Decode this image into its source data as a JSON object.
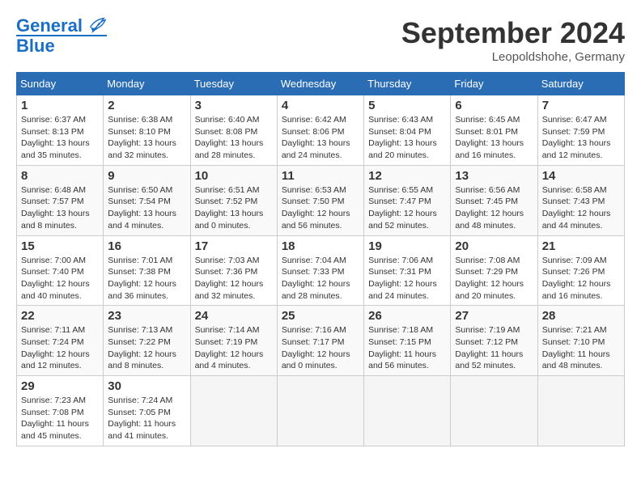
{
  "header": {
    "logo_line1": "General",
    "logo_line2": "Blue",
    "month": "September 2024",
    "location": "Leopoldshohe, Germany"
  },
  "weekdays": [
    "Sunday",
    "Monday",
    "Tuesday",
    "Wednesday",
    "Thursday",
    "Friday",
    "Saturday"
  ],
  "weeks": [
    [
      {
        "day": "1",
        "info": "Sunrise: 6:37 AM\nSunset: 8:13 PM\nDaylight: 13 hours\nand 35 minutes."
      },
      {
        "day": "2",
        "info": "Sunrise: 6:38 AM\nSunset: 8:10 PM\nDaylight: 13 hours\nand 32 minutes."
      },
      {
        "day": "3",
        "info": "Sunrise: 6:40 AM\nSunset: 8:08 PM\nDaylight: 13 hours\nand 28 minutes."
      },
      {
        "day": "4",
        "info": "Sunrise: 6:42 AM\nSunset: 8:06 PM\nDaylight: 13 hours\nand 24 minutes."
      },
      {
        "day": "5",
        "info": "Sunrise: 6:43 AM\nSunset: 8:04 PM\nDaylight: 13 hours\nand 20 minutes."
      },
      {
        "day": "6",
        "info": "Sunrise: 6:45 AM\nSunset: 8:01 PM\nDaylight: 13 hours\nand 16 minutes."
      },
      {
        "day": "7",
        "info": "Sunrise: 6:47 AM\nSunset: 7:59 PM\nDaylight: 13 hours\nand 12 minutes."
      }
    ],
    [
      {
        "day": "8",
        "info": "Sunrise: 6:48 AM\nSunset: 7:57 PM\nDaylight: 13 hours\nand 8 minutes."
      },
      {
        "day": "9",
        "info": "Sunrise: 6:50 AM\nSunset: 7:54 PM\nDaylight: 13 hours\nand 4 minutes."
      },
      {
        "day": "10",
        "info": "Sunrise: 6:51 AM\nSunset: 7:52 PM\nDaylight: 13 hours\nand 0 minutes."
      },
      {
        "day": "11",
        "info": "Sunrise: 6:53 AM\nSunset: 7:50 PM\nDaylight: 12 hours\nand 56 minutes."
      },
      {
        "day": "12",
        "info": "Sunrise: 6:55 AM\nSunset: 7:47 PM\nDaylight: 12 hours\nand 52 minutes."
      },
      {
        "day": "13",
        "info": "Sunrise: 6:56 AM\nSunset: 7:45 PM\nDaylight: 12 hours\nand 48 minutes."
      },
      {
        "day": "14",
        "info": "Sunrise: 6:58 AM\nSunset: 7:43 PM\nDaylight: 12 hours\nand 44 minutes."
      }
    ],
    [
      {
        "day": "15",
        "info": "Sunrise: 7:00 AM\nSunset: 7:40 PM\nDaylight: 12 hours\nand 40 minutes."
      },
      {
        "day": "16",
        "info": "Sunrise: 7:01 AM\nSunset: 7:38 PM\nDaylight: 12 hours\nand 36 minutes."
      },
      {
        "day": "17",
        "info": "Sunrise: 7:03 AM\nSunset: 7:36 PM\nDaylight: 12 hours\nand 32 minutes."
      },
      {
        "day": "18",
        "info": "Sunrise: 7:04 AM\nSunset: 7:33 PM\nDaylight: 12 hours\nand 28 minutes."
      },
      {
        "day": "19",
        "info": "Sunrise: 7:06 AM\nSunset: 7:31 PM\nDaylight: 12 hours\nand 24 minutes."
      },
      {
        "day": "20",
        "info": "Sunrise: 7:08 AM\nSunset: 7:29 PM\nDaylight: 12 hours\nand 20 minutes."
      },
      {
        "day": "21",
        "info": "Sunrise: 7:09 AM\nSunset: 7:26 PM\nDaylight: 12 hours\nand 16 minutes."
      }
    ],
    [
      {
        "day": "22",
        "info": "Sunrise: 7:11 AM\nSunset: 7:24 PM\nDaylight: 12 hours\nand 12 minutes."
      },
      {
        "day": "23",
        "info": "Sunrise: 7:13 AM\nSunset: 7:22 PM\nDaylight: 12 hours\nand 8 minutes."
      },
      {
        "day": "24",
        "info": "Sunrise: 7:14 AM\nSunset: 7:19 PM\nDaylight: 12 hours\nand 4 minutes."
      },
      {
        "day": "25",
        "info": "Sunrise: 7:16 AM\nSunset: 7:17 PM\nDaylight: 12 hours\nand 0 minutes."
      },
      {
        "day": "26",
        "info": "Sunrise: 7:18 AM\nSunset: 7:15 PM\nDaylight: 11 hours\nand 56 minutes."
      },
      {
        "day": "27",
        "info": "Sunrise: 7:19 AM\nSunset: 7:12 PM\nDaylight: 11 hours\nand 52 minutes."
      },
      {
        "day": "28",
        "info": "Sunrise: 7:21 AM\nSunset: 7:10 PM\nDaylight: 11 hours\nand 48 minutes."
      }
    ],
    [
      {
        "day": "29",
        "info": "Sunrise: 7:23 AM\nSunset: 7:08 PM\nDaylight: 11 hours\nand 45 minutes."
      },
      {
        "day": "30",
        "info": "Sunrise: 7:24 AM\nSunset: 7:05 PM\nDaylight: 11 hours\nand 41 minutes."
      },
      {
        "day": "",
        "info": ""
      },
      {
        "day": "",
        "info": ""
      },
      {
        "day": "",
        "info": ""
      },
      {
        "day": "",
        "info": ""
      },
      {
        "day": "",
        "info": ""
      }
    ]
  ]
}
